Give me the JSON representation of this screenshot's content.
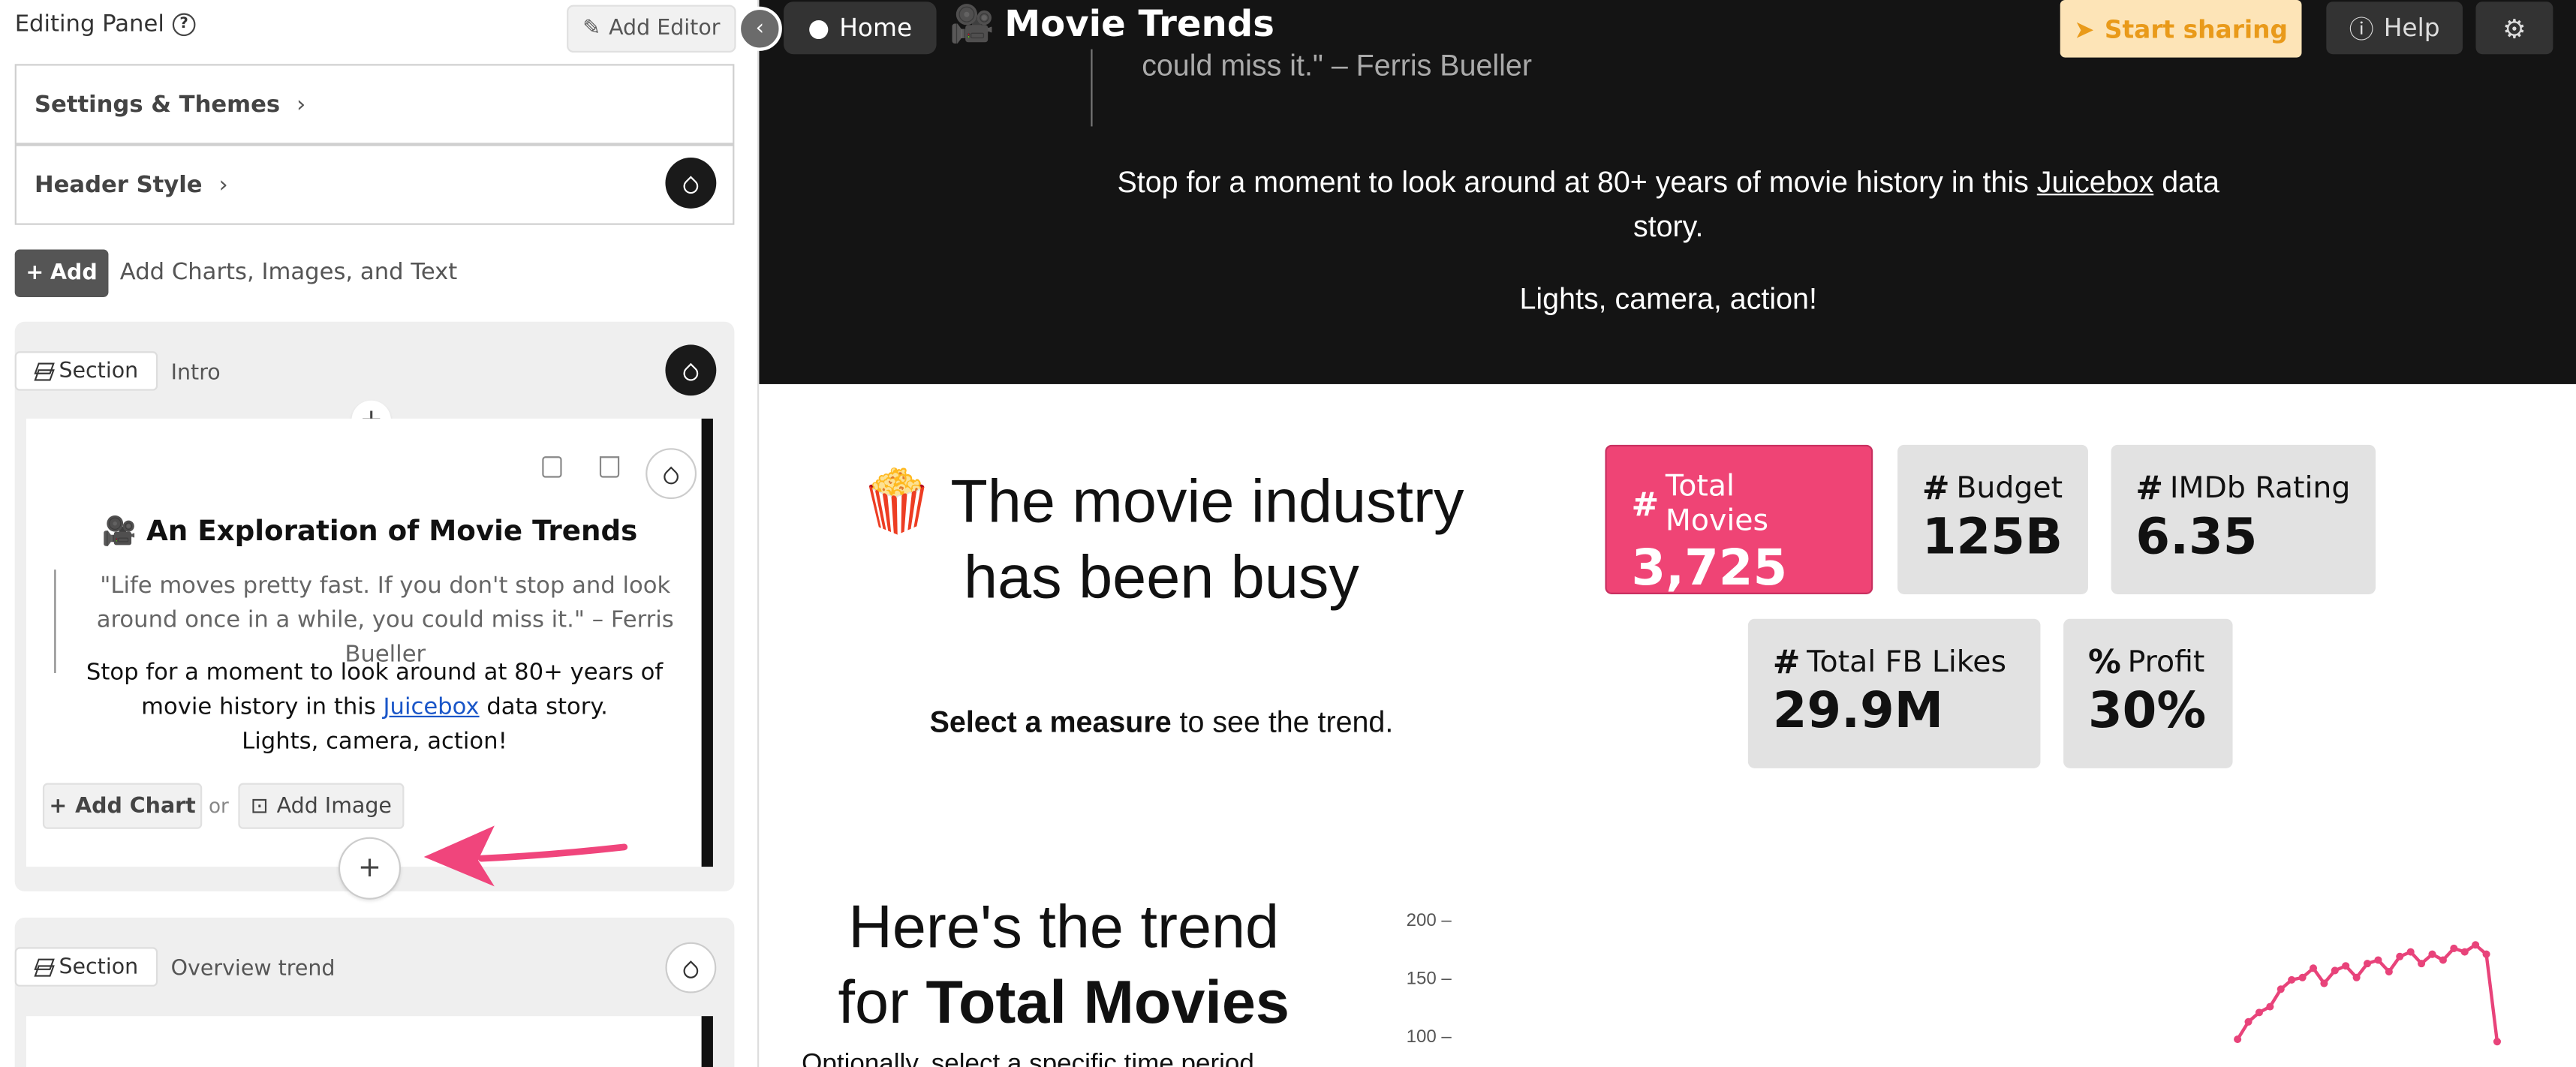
{
  "panel": {
    "title": "Editing Panel",
    "help_glyph": "?",
    "add_editor_label": "Add Editor",
    "collapse_glyph": "‹",
    "settings_label": "Settings & Themes",
    "header_style_label": "Header Style",
    "chevron_glyph": "›",
    "add_label": "Add",
    "add_hint": "Add Charts, Images, and Text",
    "sections": [
      {
        "tag": "Section",
        "name": "Intro",
        "preview": {
          "title": "🎥 An Exploration of Movie Trends",
          "quote": "\"Life moves pretty fast. If you don't stop and look around once in a while, you could miss it.\" – Ferris Bueller",
          "body_before": "Stop for a moment to look around at 80+ years of movie history in this ",
          "link": "Juicebox",
          "body_after": " data story.",
          "action": "Lights, camera, action!"
        },
        "add_chart_label": "Add Chart",
        "or_label": "or",
        "add_image_label": "Add Image"
      },
      {
        "tag": "Section",
        "name": "Overview trend"
      }
    ]
  },
  "topbar": {
    "home_label": "Home",
    "title": "Movie Trends",
    "share_label": "Start sharing",
    "help_label": "Help"
  },
  "hero": {
    "quote_tail": "could miss it.\" – Ferris Bueller",
    "body_before": "Stop for a moment to look around at 80+ years of movie history in this ",
    "link": "Juicebox",
    "body_after": " data story.",
    "action": "Lights, camera, action!"
  },
  "metrics": {
    "heading": "🍿 The movie industry has been busy",
    "sub_bold": "Select a measure",
    "sub_rest": " to see the trend.",
    "items": [
      {
        "symbol": "#",
        "label": "Total Movies",
        "value": "3,725",
        "active": true
      },
      {
        "symbol": "#",
        "label": "Budget",
        "value": "125B",
        "active": false
      },
      {
        "symbol": "#",
        "label": "IMDb Rating",
        "value": "6.35",
        "active": false
      },
      {
        "symbol": "#",
        "label": "Total FB Likes",
        "value": "29.9M",
        "active": false
      },
      {
        "symbol": "%",
        "label": "Profit",
        "value": "30%",
        "active": false
      }
    ]
  },
  "trend": {
    "heading_line1": "Here's the trend",
    "heading_pre": "for ",
    "heading_bold": "Total Movies",
    "sub": "Optionally, select a specific time period"
  },
  "chart_data": {
    "type": "line",
    "y_ticks": [
      "200 –",
      "150 –",
      "100 –"
    ],
    "ylim": [
      100,
      200
    ],
    "series": [
      {
        "values": [
          97,
          112,
          120,
          125,
          140,
          148,
          150,
          158,
          145,
          156,
          160,
          150,
          162,
          165,
          155,
          168,
          172,
          162,
          170,
          165,
          175,
          172,
          178,
          170,
          95
        ]
      }
    ],
    "line_color": "#e8437a"
  },
  "colors": {
    "accent": "#ef4475",
    "share_bg": "#fde4b7",
    "share_fg": "#e99a1a",
    "hero_bg": "#141414"
  }
}
